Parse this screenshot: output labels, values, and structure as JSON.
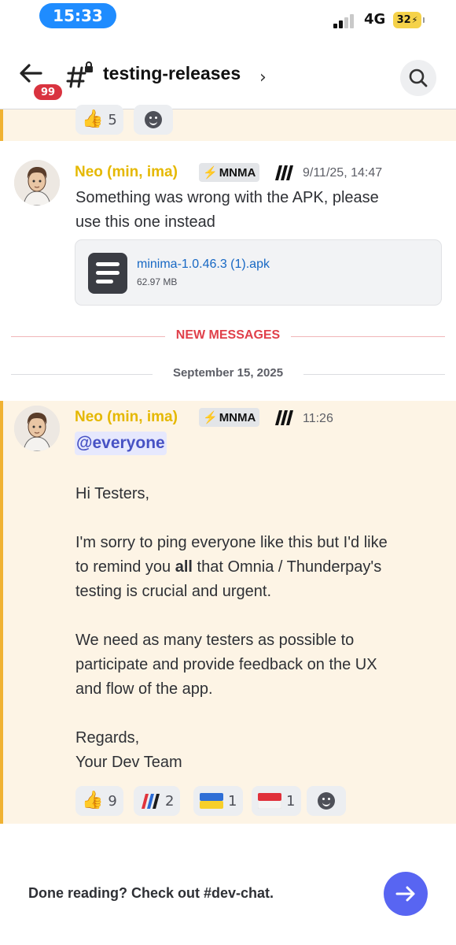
{
  "status_bar": {
    "time": "15:33",
    "network": "4G",
    "battery": "32"
  },
  "header": {
    "unread_count": "99",
    "channel_name": "testing-releases",
    "chevron": "›"
  },
  "top_reactions": [
    {
      "emoji": "👍",
      "count": "5"
    }
  ],
  "message_1": {
    "author": "Neo (min, ima)",
    "tag": "MNMA",
    "timestamp": "9/11/25, 14:47",
    "text_line1": "Something was wrong  with the APK, please",
    "text_line2": "use this one instead",
    "attachment": {
      "name": "minima-1.0.46.3 (1).apk",
      "size": "62.97 MB"
    }
  },
  "new_messages_label": "NEW MESSAGES",
  "date_separator": "September 15, 2025",
  "message_2": {
    "author": "Neo (min, ima)",
    "tag": "MNMA",
    "timestamp": "11:26",
    "mention": "@everyone",
    "greeting": "Hi Testers,",
    "para1_line1": "I'm sorry to ping everyone like this but I'd like",
    "para1_line2_pre": "to remind you ",
    "para1_line2_bold": "all",
    "para1_line2_post": " that Omnia / Thunderpay's",
    "para1_line3": "testing is crucial and urgent.",
    "para2_line1": "We need as many testers as possible to",
    "para2_line2": "participate and provide feedback on the UX",
    "para2_line3": "and flow of the app.",
    "signoff1": "Regards,",
    "signoff2": "Your Dev Team",
    "reactions": [
      {
        "emoji": "👍",
        "count": "9"
      },
      {
        "emoji": "brand",
        "count": "2"
      },
      {
        "emoji": "🇺🇦",
        "count": "1"
      },
      {
        "emoji": "🇮🇩",
        "count": "1"
      }
    ]
  },
  "footer": {
    "prompt": "Done reading? Check out #dev-chat."
  },
  "colors": {
    "accent": "#5865f2",
    "author": "#e5b800",
    "highlight": "#fdf4e5",
    "highlight_bar": "#f0b232",
    "new_messages": "#e0404a"
  },
  "icons": [
    "back-arrow-icon",
    "channel-hash-lock-icon",
    "search-icon",
    "chevron-right-icon",
    "file-icon",
    "add-reaction-icon",
    "arrow-right-icon"
  ]
}
